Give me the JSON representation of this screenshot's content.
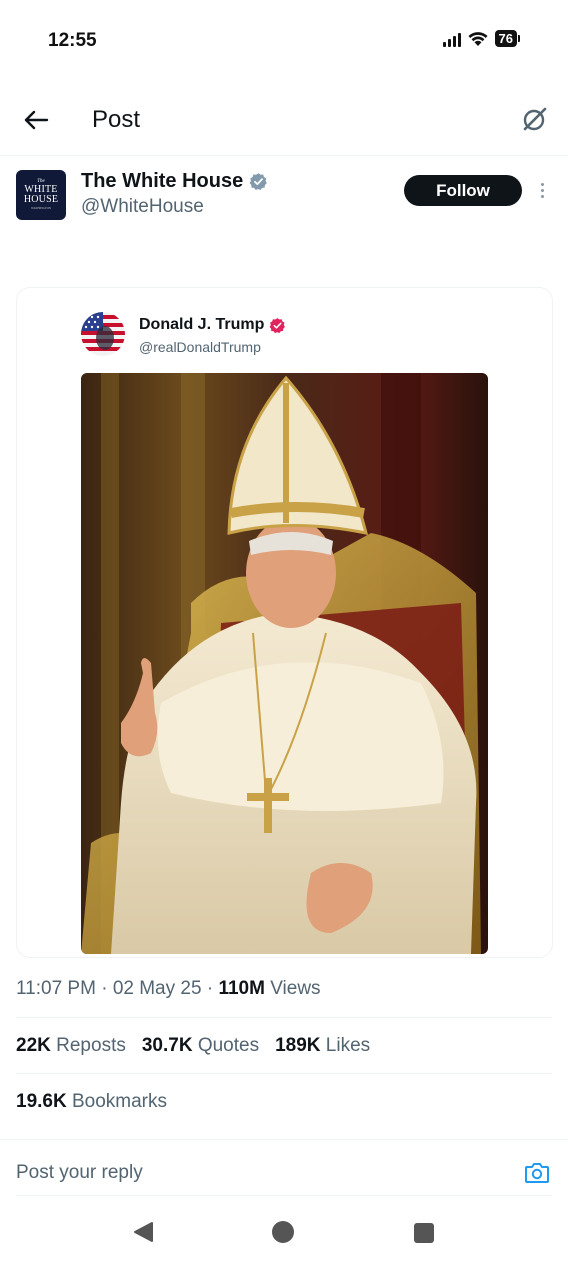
{
  "status_bar": {
    "time": "12:55",
    "battery": "76"
  },
  "header": {
    "title": "Post",
    "back_icon": "arrow-left-icon",
    "grok_icon": "grok-icon"
  },
  "post": {
    "author": {
      "name": "The White House",
      "handle": "@WhiteHouse",
      "avatar_text": [
        "The",
        "WHITE",
        "HOUSE",
        "WASHINGTON"
      ],
      "verified_color": "#829aab"
    },
    "follow_label": "Follow",
    "embedded": {
      "name": "Donald J. Trump",
      "handle": "@realDonaldTrump",
      "verified_color": "#e0245e"
    },
    "meta": {
      "time": "11:07 PM",
      "date": "02 May 25",
      "views_count": "110M",
      "views_label": "Views"
    },
    "stats": {
      "reposts_count": "22K",
      "reposts_label": "Reposts",
      "quotes_count": "30.7K",
      "quotes_label": "Quotes",
      "likes_count": "189K",
      "likes_label": "Likes",
      "bookmarks_count": "19.6K",
      "bookmarks_label": "Bookmarks"
    }
  },
  "reply": {
    "placeholder": "Post your reply"
  },
  "colors": {
    "accent": "#1d9bf0",
    "text_primary": "#0f1419",
    "text_secondary": "#536471"
  }
}
